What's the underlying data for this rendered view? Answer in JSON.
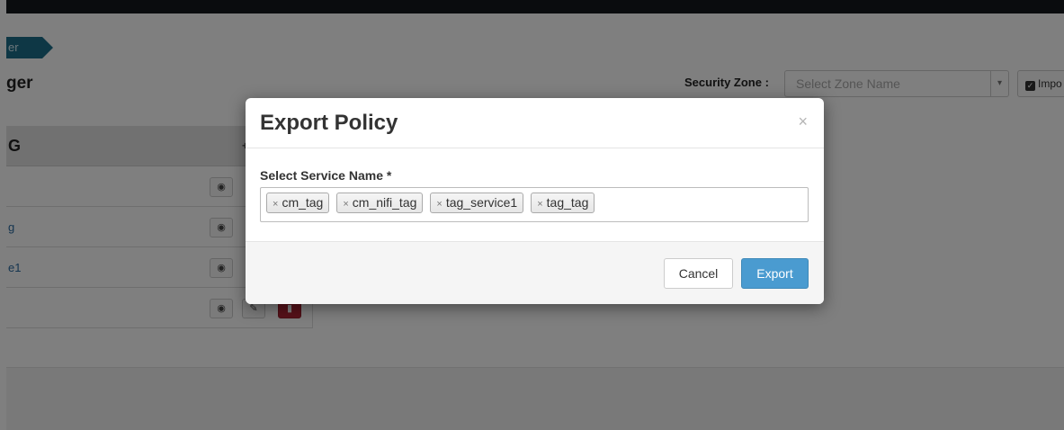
{
  "background": {
    "breadcrumb": "er",
    "heading": "ger",
    "security_zone_label": "Security Zone :",
    "zone_placeholder": "Select Zone Name",
    "zone_arrow": "▾",
    "import_label": "Impo",
    "table": {
      "header": "G",
      "rows": [
        "",
        "g",
        "e1",
        ""
      ]
    }
  },
  "modal": {
    "title": "Export Policy",
    "close_glyph": "×",
    "field_label": "Select Service Name *",
    "selected_services": [
      "cm_tag",
      "cm_nifi_tag",
      "tag_service1",
      "tag_tag"
    ],
    "tag_remove_glyph": "×",
    "cancel_label": "Cancel",
    "export_label": "Export"
  },
  "colors": {
    "primary": "#4a9bd0",
    "danger": "#b02535",
    "breadcrumb": "#1c6e8a"
  }
}
